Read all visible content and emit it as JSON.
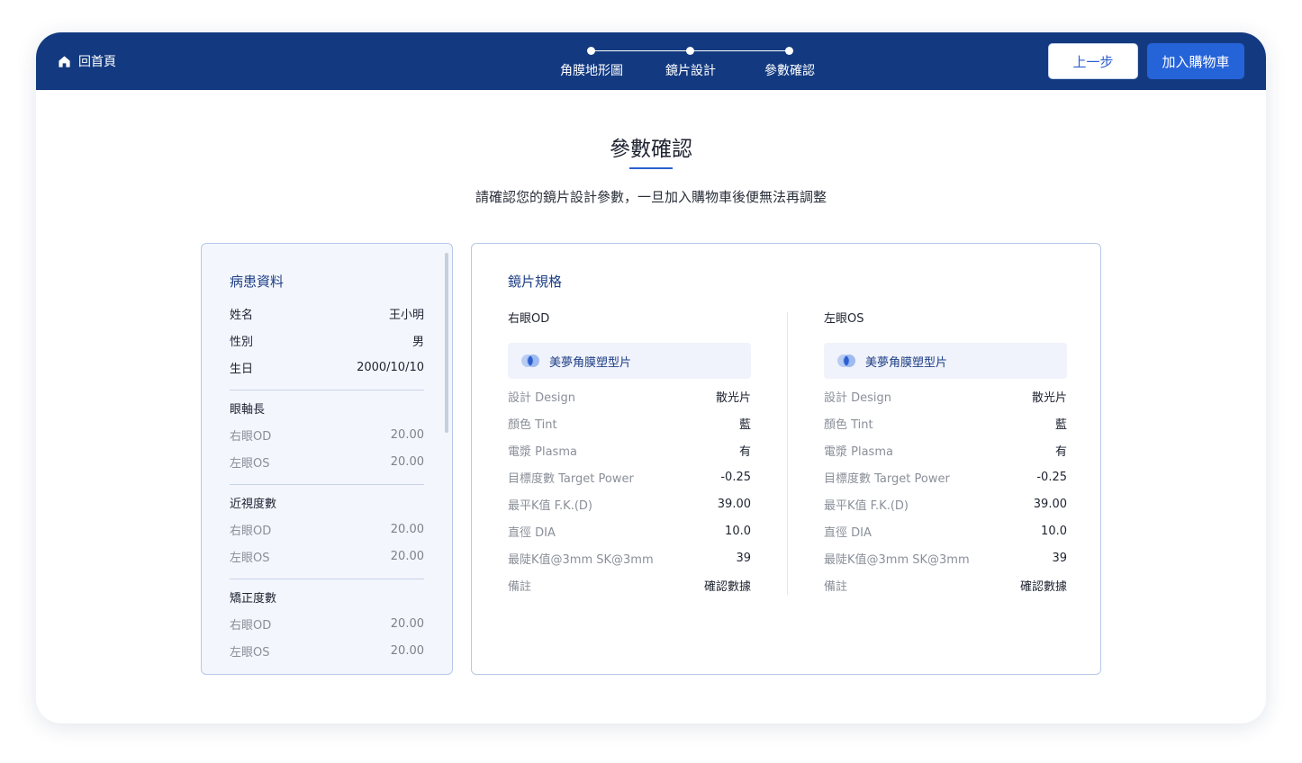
{
  "nav": {
    "home_label": "回首頁",
    "steps": [
      {
        "label": "角膜地形圖"
      },
      {
        "label": "鏡片設計"
      },
      {
        "label": "參數確認"
      }
    ],
    "prev_label": "上一步",
    "cart_label": "加入購物車"
  },
  "page": {
    "title": "參數確認",
    "subtitle": "請確認您的鏡片設計參數，一旦加入購物車後便無法再調整"
  },
  "patient": {
    "title": "病患資料",
    "basic": [
      {
        "label": "姓名",
        "value": "王小明"
      },
      {
        "label": "性別",
        "value": "男"
      },
      {
        "label": "生日",
        "value": "2000/10/10"
      }
    ],
    "groups": [
      {
        "title": "眼軸長",
        "rows": [
          {
            "label": "右眼OD",
            "value": "20.00"
          },
          {
            "label": "左眼OS",
            "value": "20.00"
          }
        ]
      },
      {
        "title": "近視度數",
        "rows": [
          {
            "label": "右眼OD",
            "value": "20.00"
          },
          {
            "label": "左眼OS",
            "value": "20.00"
          }
        ]
      },
      {
        "title": "矯正度數",
        "rows": [
          {
            "label": "右眼OD",
            "value": "20.00"
          },
          {
            "label": "左眼OS",
            "value": "20.00"
          }
        ]
      }
    ]
  },
  "lens": {
    "title": "鏡片規格",
    "eyes": [
      {
        "label": "右眼OD",
        "product": "美夢角膜塑型片",
        "specs": [
          {
            "label": "設計 Design",
            "value": "散光片"
          },
          {
            "label": "顏色 Tint",
            "value": "藍"
          },
          {
            "label": "電漿 Plasma",
            "value": "有"
          },
          {
            "label": "目標度數 Target Power",
            "value": "-0.25"
          },
          {
            "label": "最平K值 F.K.(D)",
            "value": "39.00"
          },
          {
            "label": "直徑 DIA",
            "value": "10.0"
          },
          {
            "label": "最陡K值@3mm SK@3mm",
            "value": "39"
          },
          {
            "label": "備註",
            "value": "確認數據"
          }
        ]
      },
      {
        "label": "左眼OS",
        "product": "美夢角膜塑型片",
        "specs": [
          {
            "label": "設計 Design",
            "value": "散光片"
          },
          {
            "label": "顏色 Tint",
            "value": "藍"
          },
          {
            "label": "電漿 Plasma",
            "value": "有"
          },
          {
            "label": "目標度數 Target Power",
            "value": "-0.25"
          },
          {
            "label": "最平K值 F.K.(D)",
            "value": "39.00"
          },
          {
            "label": "直徑 DIA",
            "value": "10.0"
          },
          {
            "label": "最陡K值@3mm SK@3mm",
            "value": "39"
          },
          {
            "label": "備註",
            "value": "確認數據"
          }
        ]
      }
    ]
  },
  "colors": {
    "topbar": "#133a80",
    "accent": "#2563d9",
    "card_border": "#b7c8e8"
  },
  "icons": {
    "home": "home-icon",
    "lens": "lens-icon"
  }
}
